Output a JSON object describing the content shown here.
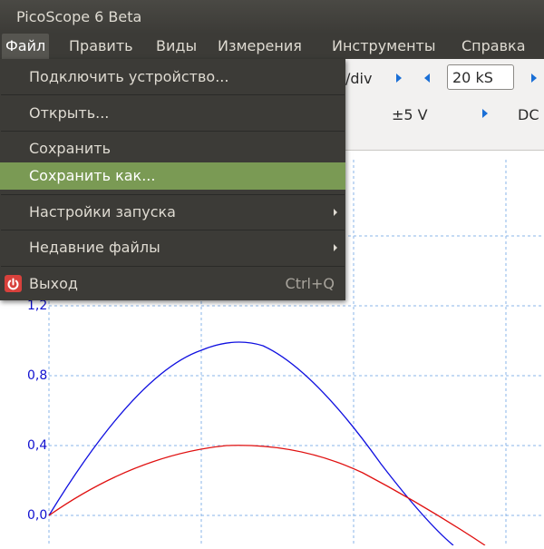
{
  "window": {
    "title": "PicoScope 6 Beta"
  },
  "menubar": {
    "items": [
      "Файл",
      "Править",
      "Виды",
      "Измерения",
      "Инструменты",
      "Справка"
    ]
  },
  "toolbar": {
    "timebase_partial": "/div",
    "samples": "20 kS",
    "range": "±5 V",
    "coupling": "DC"
  },
  "file_menu": {
    "items": [
      {
        "label": "Подключить устройство..."
      },
      {
        "label": "Открыть..."
      },
      {
        "label": "Сохранить"
      },
      {
        "label": "Сохранить как..."
      },
      {
        "label": "Настройки запуска"
      },
      {
        "label": "Недавние файлы"
      },
      {
        "label": "Выход",
        "accel": "Ctrl+Q",
        "icon": "power-icon"
      }
    ],
    "highlighted": "Сохранить как...",
    "highlight_color": "#7a9a54"
  },
  "plot": {
    "y_ticks": [
      "1,2",
      "0,8",
      "0,4",
      "0,0"
    ],
    "series_colors": [
      "#1010e0",
      "#e01010"
    ]
  }
}
